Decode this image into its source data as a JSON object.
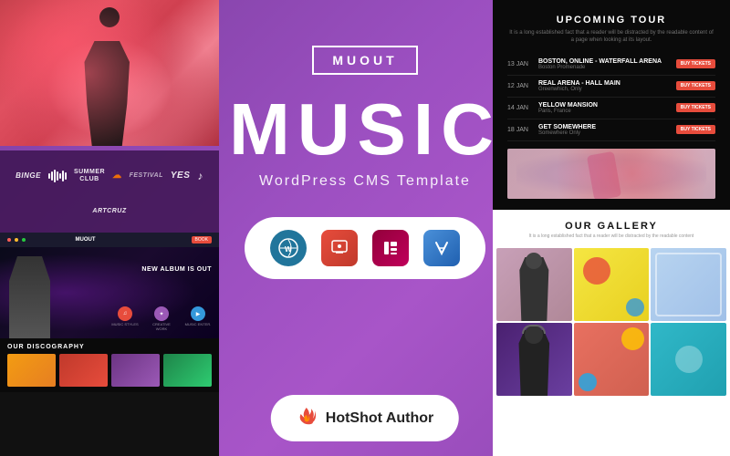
{
  "background": {
    "gradient": "linear-gradient(135deg, #7b3fa0, #a855c8)"
  },
  "top_left_image": {
    "description": "Person with red/pink smoke"
  },
  "logo_bar": {
    "logos": [
      {
        "id": "binge",
        "label": "BINGE"
      },
      {
        "id": "waveform",
        "label": "waveform"
      },
      {
        "id": "summer",
        "label": "Summer Club"
      },
      {
        "id": "soundcloud",
        "label": "soundcloud"
      },
      {
        "id": "festival",
        "label": "Festival"
      },
      {
        "id": "yes",
        "label": "Yes"
      },
      {
        "id": "music-note",
        "label": "♪"
      },
      {
        "id": "artcruz",
        "label": "ArtCruz"
      }
    ]
  },
  "center": {
    "badge": "MUOUT",
    "title": "MUSIC",
    "subtitle": "WordPress CMS Template",
    "plugins": [
      {
        "id": "wordpress",
        "label": "WP",
        "color": "#21759b"
      },
      {
        "id": "quform",
        "label": "Q",
        "color": "#e74c3c"
      },
      {
        "id": "elementor",
        "label": "E",
        "color": "#92003b"
      },
      {
        "id": "uf",
        "label": "UF",
        "color": "#4a90d9"
      }
    ]
  },
  "hotshot": {
    "icon": "🔥",
    "label": "HotShot Author"
  },
  "upcoming_tour": {
    "title": "UPCOMING TOUR",
    "subtitle": "It is a long established fact that a reader will be distracted by the readable content of a page when looking at its layout.",
    "dates": [
      {
        "date": "13 JAN",
        "venue": "BOSTON, ONLINE - WATERFALL ARENA",
        "location": "Boston Promenade",
        "status": "BUY TICKETS"
      },
      {
        "date": "12 JAN",
        "venue": "REAL ARENA - HALL MAIN",
        "location": "Greenwhich, Only",
        "status": "BUY TICKETS"
      },
      {
        "date": "14 JAN",
        "venue": "YELLOW MANSION",
        "location": "Paris, France",
        "status": "BUY TICKETS"
      },
      {
        "date": "18 JAN",
        "venue": "GET SOMEWHERE",
        "location": "Somewhere Only",
        "status": "BUY TICKETS"
      }
    ]
  },
  "theme_preview": {
    "nav_logo": "MUOUT",
    "hero_text": "NEW ALBUM IS OUT",
    "discography_title": "OUR DISCOGRAPHY",
    "icon_colors": [
      "#e74c3c",
      "#9b59b6",
      "#3498db"
    ],
    "disc_colors": [
      "#f39c12",
      "#e74c3c",
      "#9b59b6",
      "#2ecc71"
    ]
  },
  "gallery": {
    "title": "OUR GALLERY",
    "subtitle": "It is a long established fact that a reader will be distracted by the readable content",
    "cells": [
      {
        "id": 1,
        "bg": "#d4a0b0",
        "person": true
      },
      {
        "id": 2,
        "bg": "#f0c040",
        "person": false
      },
      {
        "id": 3,
        "bg": "#c0d8f0",
        "person": false
      },
      {
        "id": 4,
        "bg": "#6a3fa0",
        "person": true
      },
      {
        "id": 5,
        "bg": "#e87060",
        "person": false
      },
      {
        "id": 6,
        "bg": "#40c0d0",
        "person": false
      }
    ]
  }
}
